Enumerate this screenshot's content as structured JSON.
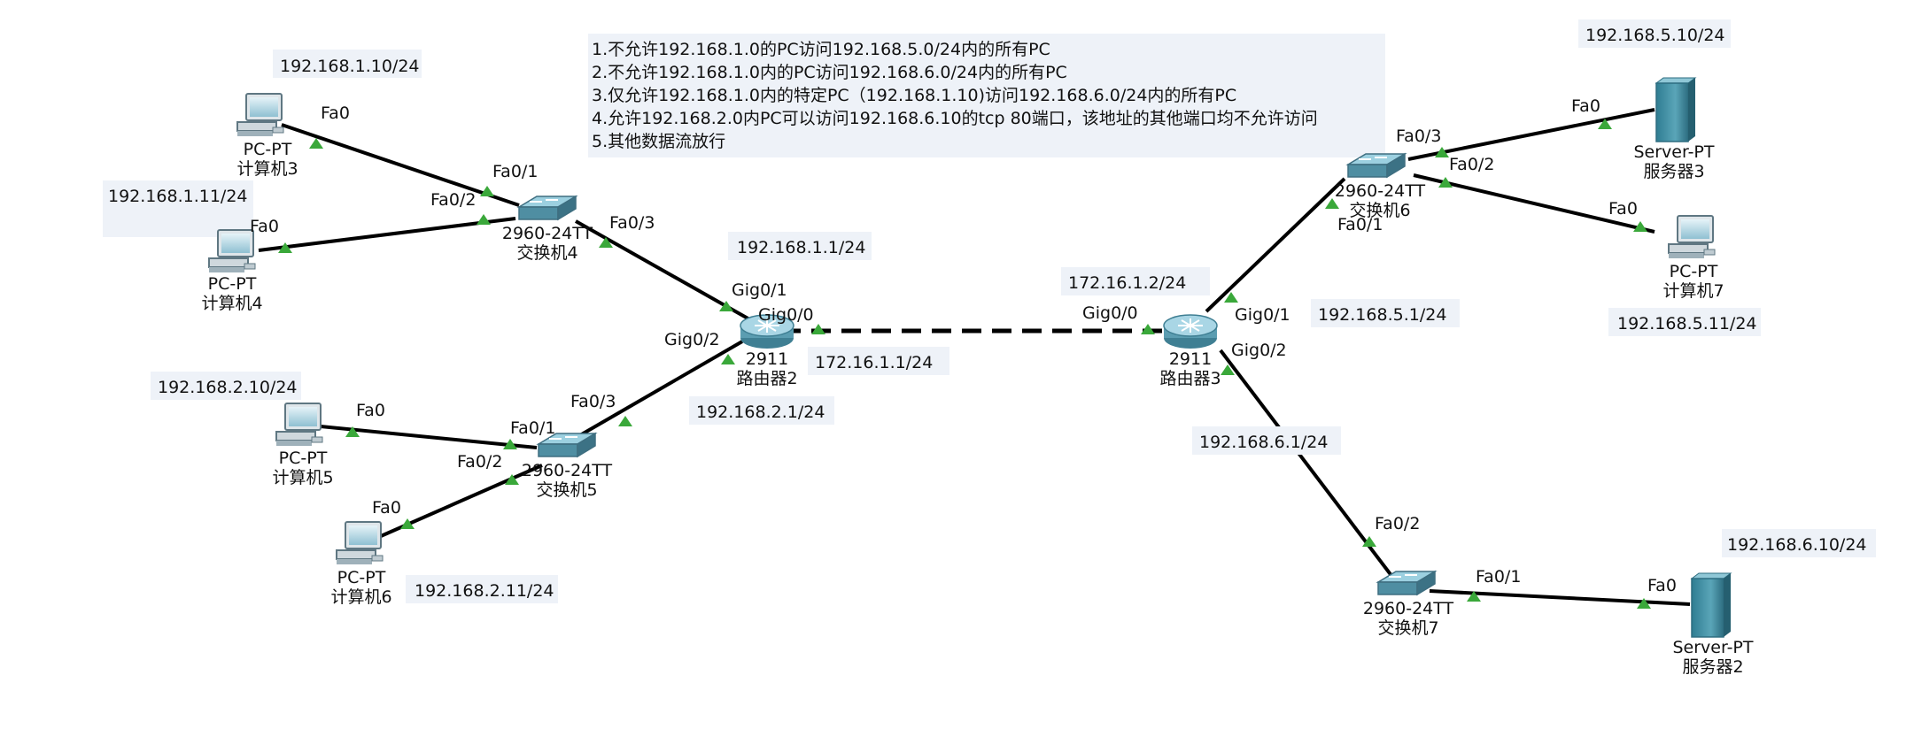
{
  "notes": {
    "n1": "1.不允许192.168.1.0的PC访问192.168.5.0/24内的所有PC",
    "n2": "2.不允许192.168.1.0内的PC访问192.168.6.0/24内的所有PC",
    "n3": "3.仅允许192.168.1.0内的特定PC（192.168.1.10)访问192.168.6.0/24内的所有PC",
    "n4": "4.允许192.168.2.0内PC可以访问192.168.6.10的tcp  80端口，该地址的其他端口均不允许访问",
    "n5": "5.其他数据流放行"
  },
  "devices": {
    "pc3": {
      "model": "PC-PT",
      "name": "计算机3",
      "ip": "192.168.1.10/24"
    },
    "pc4": {
      "model": "PC-PT",
      "name": "计算机4",
      "ip": "192.168.1.11/24"
    },
    "pc5": {
      "model": "PC-PT",
      "name": "计算机5",
      "ip": "192.168.2.10/24"
    },
    "pc6": {
      "model": "PC-PT",
      "name": "计算机6",
      "ip": "192.168.2.11/24"
    },
    "pc7": {
      "model": "PC-PT",
      "name": "计算机7",
      "ip": "192.168.5.11/24"
    },
    "sw4": {
      "model": "2960-24TT",
      "name": "交换机4"
    },
    "sw5": {
      "model": "2960-24TT",
      "name": "交换机5"
    },
    "sw6": {
      "model": "2960-24TT",
      "name": "交换机6"
    },
    "sw7": {
      "model": "2960-24TT",
      "name": "交换机7"
    },
    "r2": {
      "model": "2911",
      "name": "路由器2"
    },
    "r3": {
      "model": "2911",
      "name": "路由器3"
    },
    "srv3": {
      "model": "Server-PT",
      "name": "服务器3",
      "ip": "192.168.5.10/24"
    },
    "srv2": {
      "model": "Server-PT",
      "name": "服务器2",
      "ip": "192.168.6.10/24"
    }
  },
  "interfaces": {
    "r2_g01": "192.168.1.1/24",
    "r2_g02": "192.168.2.1/24",
    "r2_g00": "172.16.1.1/24",
    "r3_g00": "172.16.1.2/24",
    "r3_g01": "192.168.5.1/24",
    "r3_g02": "192.168.6.1/24"
  },
  "ports": {
    "fa0": "Fa0",
    "fa01": "Fa0/1",
    "fa02": "Fa0/2",
    "fa03": "Fa0/3",
    "gig00": "Gig0/0",
    "gig01": "Gig0/1",
    "gig02": "Gig0/2"
  },
  "colors": {
    "link": "#000000",
    "port_indicator": "#3aa83a",
    "ip_box": "#eef2f8"
  }
}
